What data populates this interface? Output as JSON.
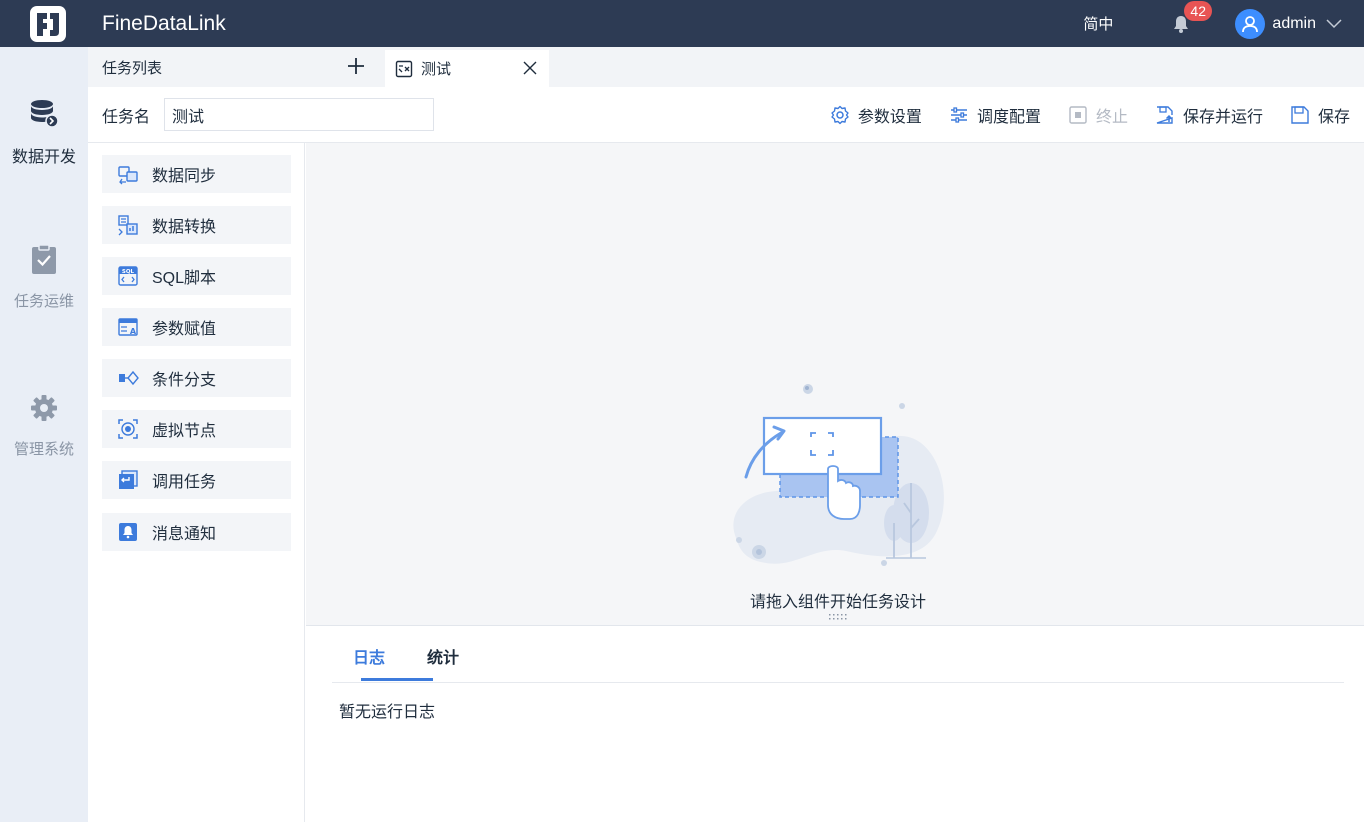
{
  "header": {
    "app_title": "FineDataLink",
    "language": "简中",
    "notification_count": "42",
    "username": "admin"
  },
  "sidebar": {
    "items": [
      {
        "label": "数据开发",
        "icon": "database-icon",
        "active": true
      },
      {
        "label": "任务运维",
        "icon": "clipboard-check-icon",
        "active": false
      },
      {
        "label": "管理系统",
        "icon": "gear-icon",
        "active": false
      }
    ]
  },
  "tabs": {
    "list_label": "任务列表",
    "active_tab": "测试"
  },
  "toolbar": {
    "task_name_label": "任务名",
    "task_name_value": "测试",
    "params_label": "参数设置",
    "schedule_label": "调度配置",
    "stop_label": "终止",
    "save_run_label": "保存并运行",
    "save_label": "保存"
  },
  "components": [
    {
      "label": "数据同步",
      "icon": "data-sync-icon"
    },
    {
      "label": "数据转换",
      "icon": "data-transform-icon"
    },
    {
      "label": "SQL脚本",
      "icon": "sql-script-icon"
    },
    {
      "label": "参数赋值",
      "icon": "param-assign-icon"
    },
    {
      "label": "条件分支",
      "icon": "condition-branch-icon"
    },
    {
      "label": "虚拟节点",
      "icon": "virtual-node-icon"
    },
    {
      "label": "调用任务",
      "icon": "invoke-task-icon"
    },
    {
      "label": "消息通知",
      "icon": "message-notify-icon"
    }
  ],
  "canvas": {
    "empty_text": "请拖入组件开始任务设计"
  },
  "log_panel": {
    "tab_log": "日志",
    "tab_stats": "统计",
    "empty_text": "暂无运行日志"
  },
  "colors": {
    "header_bg": "#2d3b54",
    "accent": "#3d7bdc",
    "badge": "#e85454",
    "sidebar_bg": "#e9eef6"
  }
}
